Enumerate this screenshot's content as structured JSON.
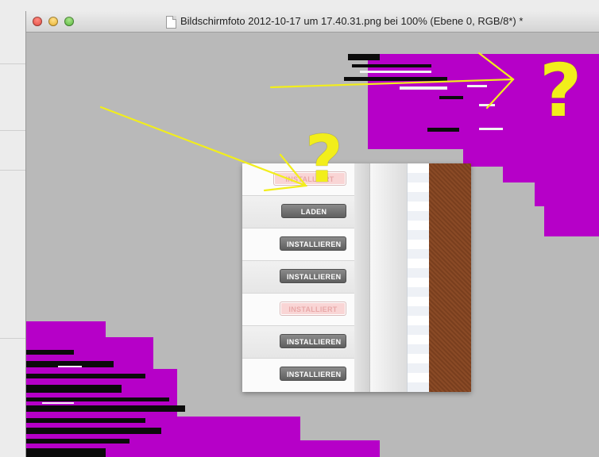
{
  "window": {
    "title": "Bildschirmfoto 2012-10-17 um 17.40.31.png bei 100% (Ebene 0, RGB/8*) *"
  },
  "panel": {
    "rows": [
      {
        "label": "INSTALLIERT",
        "state": "installed"
      },
      {
        "label": "LADEN",
        "state": "button"
      },
      {
        "label": "INSTALLIEREN",
        "state": "button"
      },
      {
        "label": "INSTALLIEREN",
        "state": "button"
      },
      {
        "label": "INSTALLIERT",
        "state": "installed"
      },
      {
        "label": "INSTALLIEREN",
        "state": "button"
      },
      {
        "label": "INSTALLIEREN",
        "state": "button"
      }
    ]
  },
  "annotations": {
    "question_mark": "?"
  },
  "colors": {
    "artifact": "#b600c8",
    "annotation": "#f2ee1b",
    "canvas": "#b9b9b9"
  }
}
